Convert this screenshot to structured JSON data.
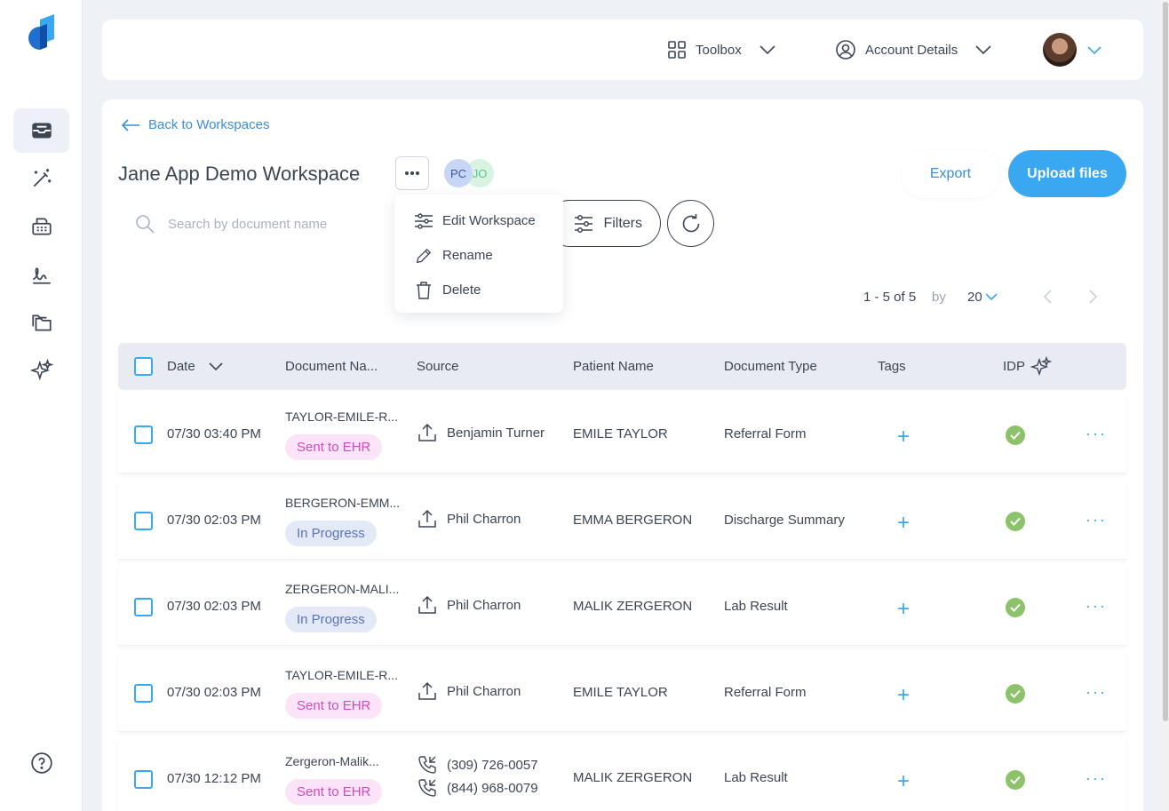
{
  "topbar": {
    "toolbox_label": "Toolbox",
    "account_label": "Account Details"
  },
  "workspace": {
    "back_label": "Back to Workspaces",
    "title": "Jane App Demo Workspace",
    "members": [
      "PC",
      "JO"
    ],
    "export_label": "Export",
    "upload_label": "Upload files"
  },
  "search": {
    "placeholder": "Search by document name"
  },
  "filters_label": "Filters",
  "menu": {
    "edit": "Edit Workspace",
    "rename": "Rename",
    "delete": "Delete"
  },
  "pager": {
    "range": "1 - 5 of 5",
    "by": "by",
    "size": "20"
  },
  "columns": {
    "date": "Date",
    "doc_name": "Document Na...",
    "source": "Source",
    "patient": "Patient Name",
    "doc_type": "Document Type",
    "tags": "Tags",
    "idp": "IDP"
  },
  "rows": [
    {
      "date": "07/30 03:40 PM",
      "doc": "TAYLOR-EMILE-R...",
      "status": "Sent to EHR",
      "source": "Benjamin Turner",
      "patient": "EMILE TAYLOR",
      "type": "Referral Form"
    },
    {
      "date": "07/30 02:03 PM",
      "doc": "BERGERON-EMM...",
      "status": "In Progress",
      "source": "Phil Charron",
      "patient": "EMMA BERGERON",
      "type": "Discharge Summary"
    },
    {
      "date": "07/30 02:03 PM",
      "doc": "ZERGERON-MALI...",
      "status": "In Progress",
      "source": "Phil Charron",
      "patient": "MALIK ZERGERON",
      "type": "Lab Result"
    },
    {
      "date": "07/30 02:03 PM",
      "doc": "TAYLOR-EMILE-R...",
      "status": "Sent to EHR",
      "source": "Phil Charron",
      "patient": "EMILE TAYLOR",
      "type": "Referral Form"
    },
    {
      "date": "07/30 12:12 PM",
      "doc": "Zergeron-Malik...",
      "status": "Sent to EHR",
      "source_phone_in": "(309) 726-0057",
      "source_phone_out": "(844) 968-0079",
      "patient": "MALIK ZERGERON",
      "type": "Lab Result"
    }
  ],
  "colors": {
    "accent": "#3aa8f0",
    "link": "#3a8fd8",
    "sent_bg": "#fbe4f7",
    "sent_fg": "#d04ac0",
    "progress_bg": "#e3e9f7",
    "progress_fg": "#5a73b8",
    "idp_check": "#8bc26a"
  },
  "icons": {
    "sidebar": [
      "inbox-icon",
      "magic-wand-icon",
      "fax-icon",
      "signature-icon",
      "folders-icon",
      "sparkles-icon",
      "help-icon"
    ]
  }
}
